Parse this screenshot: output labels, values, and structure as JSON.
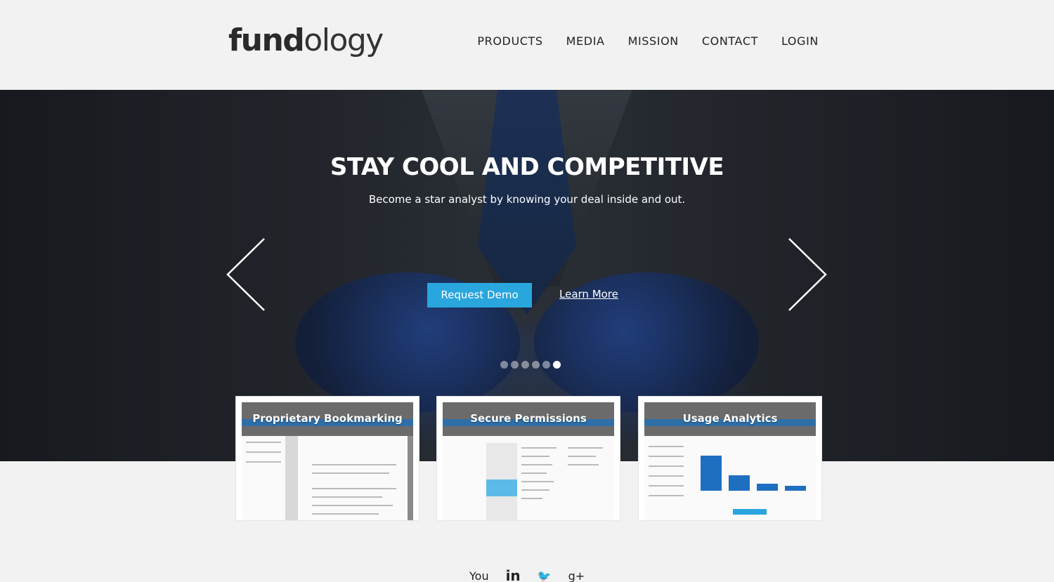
{
  "brand": {
    "logo_bold": "fund",
    "logo_light": "ology"
  },
  "nav": {
    "items": [
      {
        "label": "PRODUCTS"
      },
      {
        "label": "MEDIA"
      },
      {
        "label": "MISSION"
      },
      {
        "label": "CONTACT"
      },
      {
        "label": "LOGIN"
      }
    ]
  },
  "hero": {
    "title": "STAY COOL AND COMPETITIVE",
    "subtitle": "Become a star analyst by knowing your deal inside and out.",
    "primary_button": "Request Demo",
    "secondary_link": "Learn More",
    "slide_count": 6,
    "active_slide": 6,
    "prev_icon": "chevron-left-icon",
    "next_icon": "chevron-right-icon"
  },
  "features": [
    {
      "title": "Proprietary Bookmarking"
    },
    {
      "title": "Secure Permissions"
    },
    {
      "title": "Usage Analytics"
    }
  ],
  "social": {
    "icons": [
      "youtube-icon",
      "linkedin-icon",
      "twitter-icon",
      "google-plus-icon"
    ],
    "labels": [
      "You",
      "in",
      "🐦",
      "g+"
    ]
  },
  "colors": {
    "accent": "#29a6dd",
    "background": "#f2f2f2"
  }
}
